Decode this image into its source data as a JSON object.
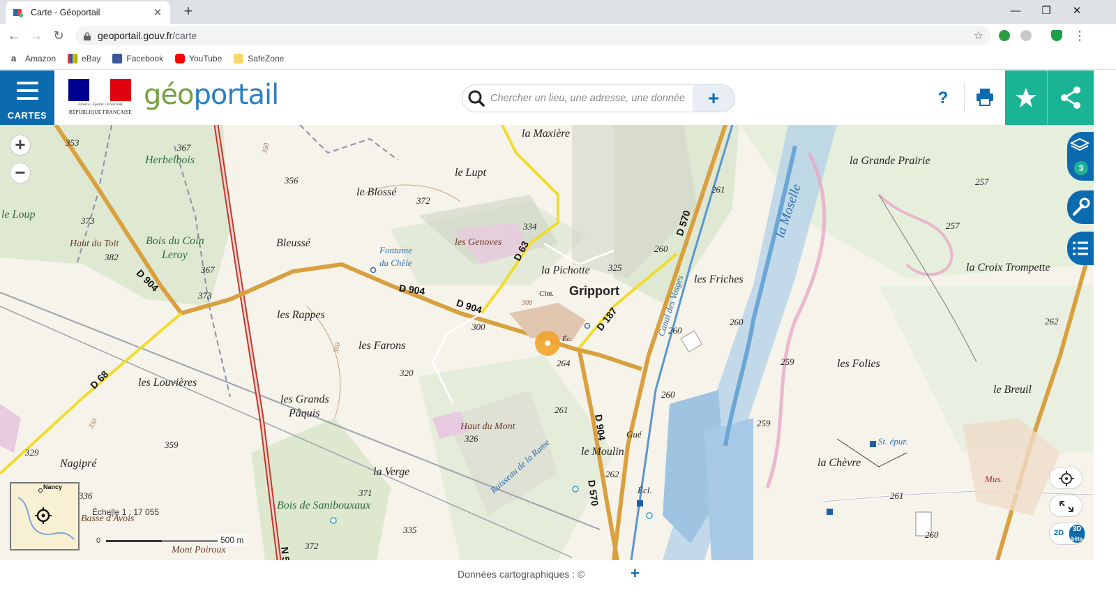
{
  "browser": {
    "tab_title": "Carte - Géoportail",
    "url_host": "geoportail.gouv.fr",
    "url_path": "/carte",
    "bookmarks": [
      "Amazon",
      "eBay",
      "Facebook",
      "YouTube",
      "SafeZone"
    ]
  },
  "header": {
    "menu_label": "CARTES",
    "motto": "Liberté • Égalité • Fraternité",
    "republic": "RÉPUBLIQUE FRANÇAISE",
    "logo_part1": "géo",
    "logo_part2": "portail",
    "search_placeholder": "Chercher un lieu, une adresse, une donnée",
    "help_label": "?"
  },
  "colors": {
    "brand_blue": "#0c6aaf",
    "accent_green": "#1ab394",
    "road_orange": "#d9a03f",
    "road_yellow": "#f1dc2c"
  },
  "map": {
    "places": [
      {
        "label": "la Maxière",
        "style": "normal"
      },
      {
        "label": "le Lupt",
        "style": "normal"
      },
      {
        "label": "le Blossé",
        "style": "normal"
      },
      {
        "label": "Herbelbois",
        "style": "green"
      },
      {
        "label": "le Loup",
        "style": "green"
      },
      {
        "label": "Haut du Toit",
        "style": "brown"
      },
      {
        "label": "Bois du Coin",
        "style": "green"
      },
      {
        "label": "Leroy",
        "style": "green"
      },
      {
        "label": "Bleussé",
        "style": "normal"
      },
      {
        "label": "Fontaine",
        "style": "water"
      },
      {
        "label": "du Chêle",
        "style": "water"
      },
      {
        "label": "les Genoves",
        "style": "brown"
      },
      {
        "label": "la Pichotte",
        "style": "normal"
      },
      {
        "label": "Gripport",
        "style": "bold"
      },
      {
        "label": "Cim.",
        "style": "small"
      },
      {
        "label": "Éc.",
        "style": "small"
      },
      {
        "label": "les Rappes",
        "style": "normal"
      },
      {
        "label": "les Farons",
        "style": "normal"
      },
      {
        "label": "les Louvières",
        "style": "normal"
      },
      {
        "label": "les Grands",
        "style": "normal"
      },
      {
        "label": "Pâquis",
        "style": "normal"
      },
      {
        "label": "Nagipré",
        "style": "normal"
      },
      {
        "label": "Haut du Mont",
        "style": "brown"
      },
      {
        "label": "la Verge",
        "style": "normal"
      },
      {
        "label": "Bois de Sanibouxaux",
        "style": "green"
      },
      {
        "label": "Basse d'Avois",
        "style": "brown"
      },
      {
        "label": "Mont Poiroux",
        "style": "brown"
      },
      {
        "label": "le Moulin",
        "style": "normal"
      },
      {
        "label": "Gué",
        "style": "small"
      },
      {
        "label": "Écl.",
        "style": "small"
      },
      {
        "label": "Ruisseau de la Rame",
        "style": "water"
      },
      {
        "label": "Canal des Vosges",
        "style": "water"
      },
      {
        "label": "la Moselle",
        "style": "water"
      },
      {
        "label": "les Friches",
        "style": "normal"
      },
      {
        "label": "la Grande Prairie",
        "style": "normal"
      },
      {
        "label": "la Croix Trompette",
        "style": "normal"
      },
      {
        "label": "les Folies",
        "style": "normal"
      },
      {
        "label": "le Breuil",
        "style": "normal"
      },
      {
        "label": "la Chèvre",
        "style": "normal"
      },
      {
        "label": "St. épur.",
        "style": "water"
      },
      {
        "label": "Mus.",
        "style": "brown"
      }
    ],
    "elevations": [
      "353",
      "367",
      "356",
      "372",
      "350",
      "373",
      "382",
      "367",
      "373",
      "334",
      "325",
      "300",
      "300",
      "320",
      "350",
      "350",
      "359",
      "329",
      "336",
      "371",
      "335",
      "372",
      "264",
      "261",
      "326",
      "262",
      "261",
      "260",
      "260",
      "260",
      "260",
      "259",
      "259",
      "257",
      "257",
      "262",
      "261",
      "260"
    ],
    "roads": [
      "D 904",
      "D 904",
      "D 904",
      "D 63",
      "D 187",
      "D 570",
      "D 68",
      "D 904",
      "D 570",
      "N 5"
    ],
    "overview_label": "Nancy",
    "scale_text": "Échelle 1 : 17 055",
    "scale_zero": "0",
    "scale_distance": "500 m",
    "layers_count": "3",
    "mode_2d": "2D",
    "mode_3d": "3D",
    "mode_beta": "bêta"
  },
  "footer": {
    "credits": "Données cartographiques : ©"
  }
}
